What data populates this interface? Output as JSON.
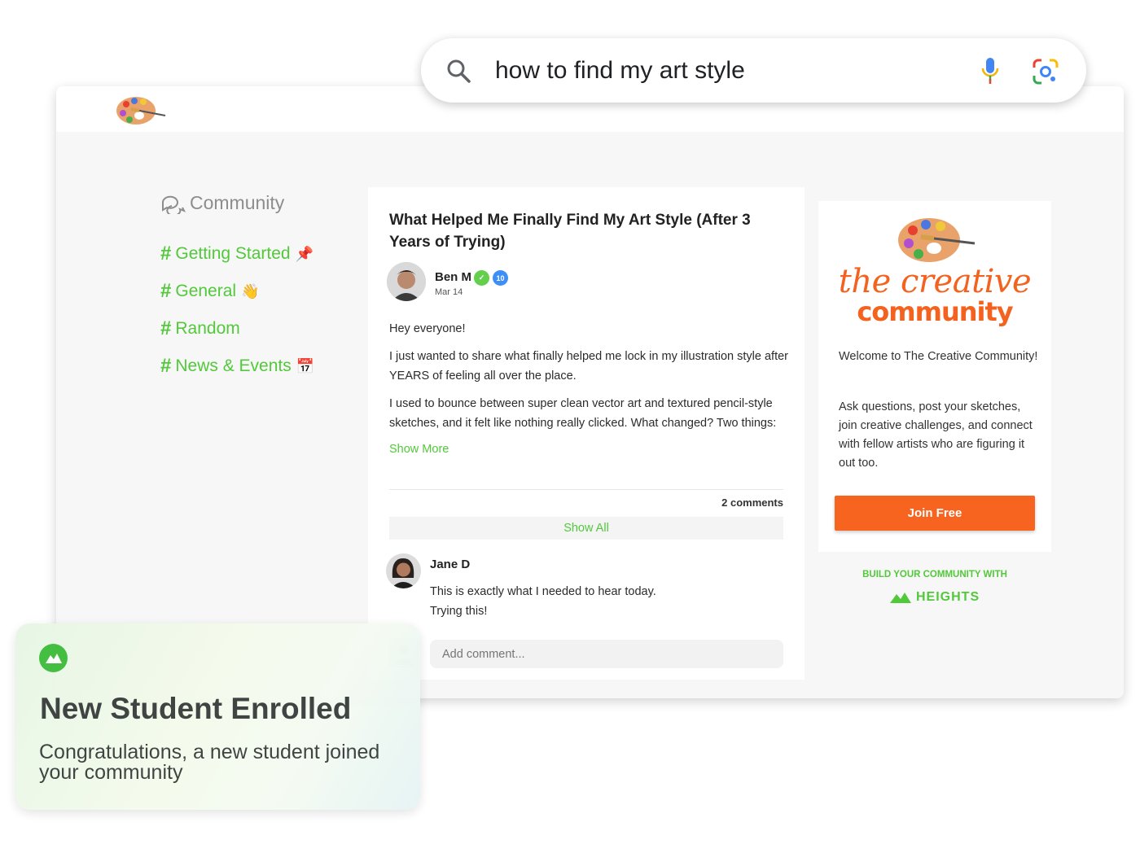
{
  "search": {
    "query": "how to find my art style"
  },
  "nav": {
    "title": "Community",
    "items": [
      {
        "label": "Getting Started",
        "emoji": "📌"
      },
      {
        "label": "General",
        "emoji": "👋"
      },
      {
        "label": "Random",
        "emoji": ""
      },
      {
        "label": "News & Events",
        "emoji": "📅"
      }
    ]
  },
  "post": {
    "title": "What Helped Me Finally Find My Art Style (After 3 Years of Trying)",
    "author": "Ben M",
    "badge_count": "10",
    "date": "Mar 14",
    "paragraphs": [
      "Hey everyone!",
      "I just wanted to share what finally helped me lock in my illustration style after YEARS of feeling all over the place.",
      "I used to bounce between super clean vector art and textured pencil-style sketches, and it felt like nothing really clicked. What changed? Two things:"
    ],
    "show_more": "Show More",
    "comments_count": "2 comments",
    "show_all": "Show All",
    "comment": {
      "author": "Jane D",
      "text_line1": "This is exactly what I needed to hear today.",
      "text_line2": "Trying this!"
    },
    "add_comment_placeholder": "Add comment..."
  },
  "sidebar": {
    "brand_line1": "the creative",
    "brand_line2": "community",
    "welcome": "Welcome to The Creative Community!",
    "description": "Ask questions, post your sketches, join creative challenges, and connect with fellow artists who are figuring it out too.",
    "join_label": "Join Free",
    "build_label": "BUILD YOUR COMMUNITY WITH",
    "heights_label": "HEIGHTS"
  },
  "notification": {
    "title": "New Student Enrolled",
    "subtitle": "Congratulations, a new student joined your community"
  },
  "colors": {
    "accent_green": "#52c93a",
    "brand_orange": "#f4621f",
    "join_button": "#f7641f"
  }
}
